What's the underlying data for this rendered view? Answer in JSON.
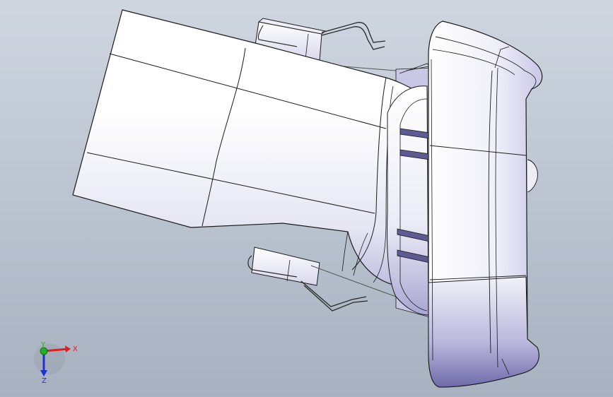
{
  "viewport": {
    "background_top": "#cfd6e0",
    "background_bottom": "#a7b1bf"
  },
  "model": {
    "shade_light": "#ffffff",
    "shade_mid": "#d9d9ec",
    "shade_dark": "#8e8cc2",
    "edge_color": "#1a1a1a"
  },
  "triad": {
    "x_label": "X",
    "y_label": "Y",
    "z_label": "Z",
    "x_color": "#e02020",
    "y_color": "#20b020",
    "z_color": "#2030d0"
  }
}
